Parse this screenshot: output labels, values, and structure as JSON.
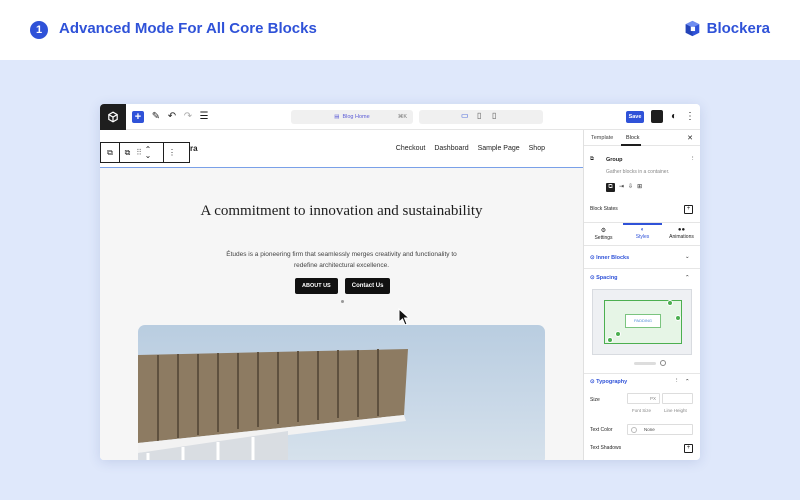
{
  "banner": {
    "step_number": "1",
    "title": "Advanced Mode For All Core Blocks",
    "brand_name": "Blockera"
  },
  "colors": {
    "accent": "#2f52d8",
    "stage_bg": "#dfe8fb",
    "padding_green": "#4caf50"
  },
  "editor": {
    "topbar": {
      "document_title": "Blog Home",
      "shortcut": "⌘K",
      "save_label": "Save"
    },
    "canvas": {
      "site_logo_fragment": "ra",
      "nav": [
        "Checkout",
        "Dashboard",
        "Sample Page",
        "Shop"
      ],
      "hero_title": "A commitment to innovation and sustainability",
      "hero_subtitle": "Études is a pioneering firm that seamlessly merges creativity and functionality to redefine architectural excellence.",
      "buttons": [
        "ABOUT US",
        "Contact Us"
      ]
    },
    "sidebar": {
      "tabs": [
        "Template",
        "Block"
      ],
      "active_tab": "Block",
      "block_name": "Group",
      "block_description": "Gather blocks in a container.",
      "block_states_label": "Block States",
      "sub_tabs": [
        "Settings",
        "Styles",
        "Animations"
      ],
      "active_sub_tab": "Styles",
      "inner_blocks_label": "Inner Blocks",
      "spacing_label": "Spacing",
      "padding_label": "PADDING",
      "typography_label": "Typography",
      "size_label": "Size",
      "size_unit": "PX",
      "font_size_label": "Font Size",
      "line_height_label": "Line Height",
      "text_color_label": "Text Color",
      "text_color_value": "None",
      "text_shadows_label": "Text Shadows"
    }
  }
}
